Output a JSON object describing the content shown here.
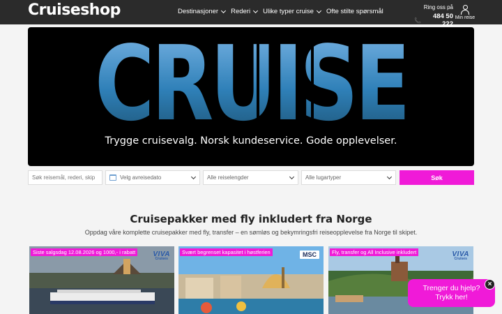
{
  "header": {
    "logo": "Cruiseshop",
    "nav": [
      {
        "label": "Destinasjoner",
        "has_dropdown": true
      },
      {
        "label": "Rederi",
        "has_dropdown": true
      },
      {
        "label": "Ulike typer cruise",
        "has_dropdown": true
      },
      {
        "label": "Ofte stilte spørsmål",
        "has_dropdown": false
      }
    ],
    "call_label": "Ring oss på",
    "phone": "484 50 222",
    "account_label": "Min reise"
  },
  "hero": {
    "headline": "CRUISE",
    "tagline": "Trygge cruisevalg. Norsk kundeservice. Gode opplevelser."
  },
  "search": {
    "query_placeholder": "Søk reisemål, rederi, skip",
    "date_label": "Velg avreisedato",
    "length_label": "Alle reiselengder",
    "cabin_label": "Alle lugartyper",
    "submit_label": "Søk"
  },
  "section": {
    "title": "Cruisepakker med fly inkludert fra Norge",
    "subtitle": "Oppdag våre komplette cruisepakker med fly, transfer – en sømløs og bekymringsfri reiseopplevelse fra Norge til skipet."
  },
  "cards": [
    {
      "badge": "Siste salgsdag 12.08.2026 og 1000,- i rabatt",
      "brand": "VIVA",
      "brand_sub": "Cruises"
    },
    {
      "badge": "Svært begrenset kapasitet i høstferien",
      "brand": "MSC",
      "brand_sub": ""
    },
    {
      "badge": "Fly, transfer og All Inclusive inkludert",
      "brand": "VIVA",
      "brand_sub": "Cruises"
    }
  ],
  "help": {
    "line1": "Trenger du hjelp?",
    "line2": "Trykk her!",
    "close": "×"
  },
  "colors": {
    "accent": "#f01ad8",
    "header_bg": "#2b2b2b",
    "hero_bg": "#000000"
  }
}
